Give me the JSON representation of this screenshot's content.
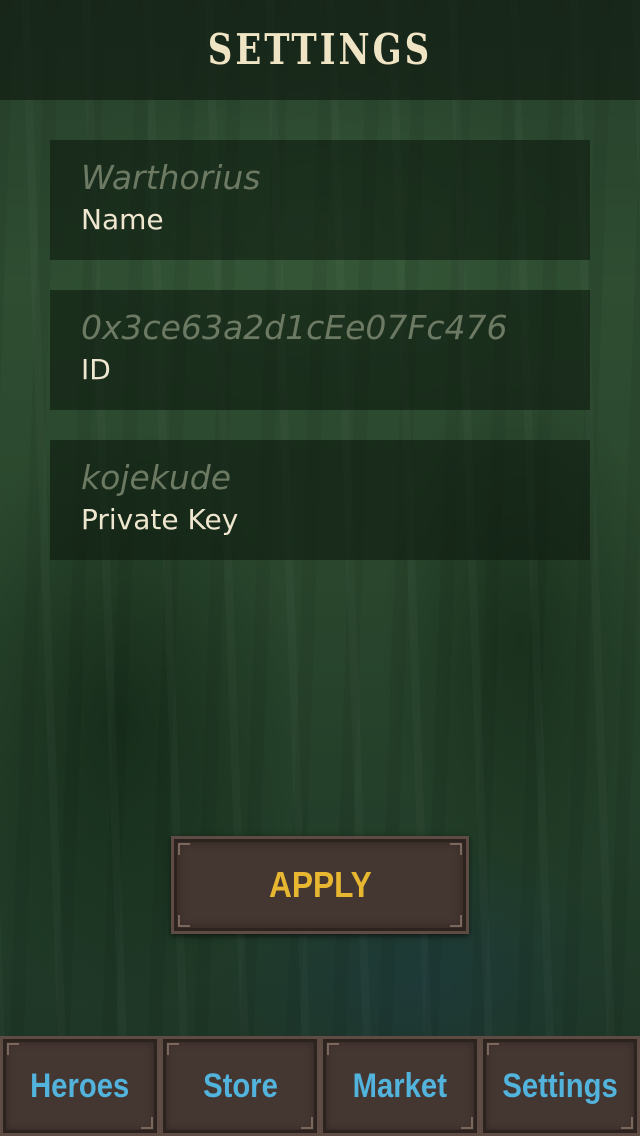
{
  "header": {
    "title": "Settings"
  },
  "fields": [
    {
      "value": "Warthorius",
      "label": "Name"
    },
    {
      "value": "0x3ce63a2d1cEe07Fc476",
      "label": "ID"
    },
    {
      "value": "kojekude",
      "label": "Private Key"
    }
  ],
  "apply_button": {
    "label": "APPLY"
  },
  "navbar": {
    "tabs": [
      {
        "label": "Heroes"
      },
      {
        "label": "Store"
      },
      {
        "label": "Market"
      },
      {
        "label": "Settings"
      }
    ]
  },
  "colors": {
    "title_text": "#efe4c4",
    "apply_text": "#e8b731",
    "nav_text": "#52b3dc",
    "button_bg": "#443631"
  }
}
